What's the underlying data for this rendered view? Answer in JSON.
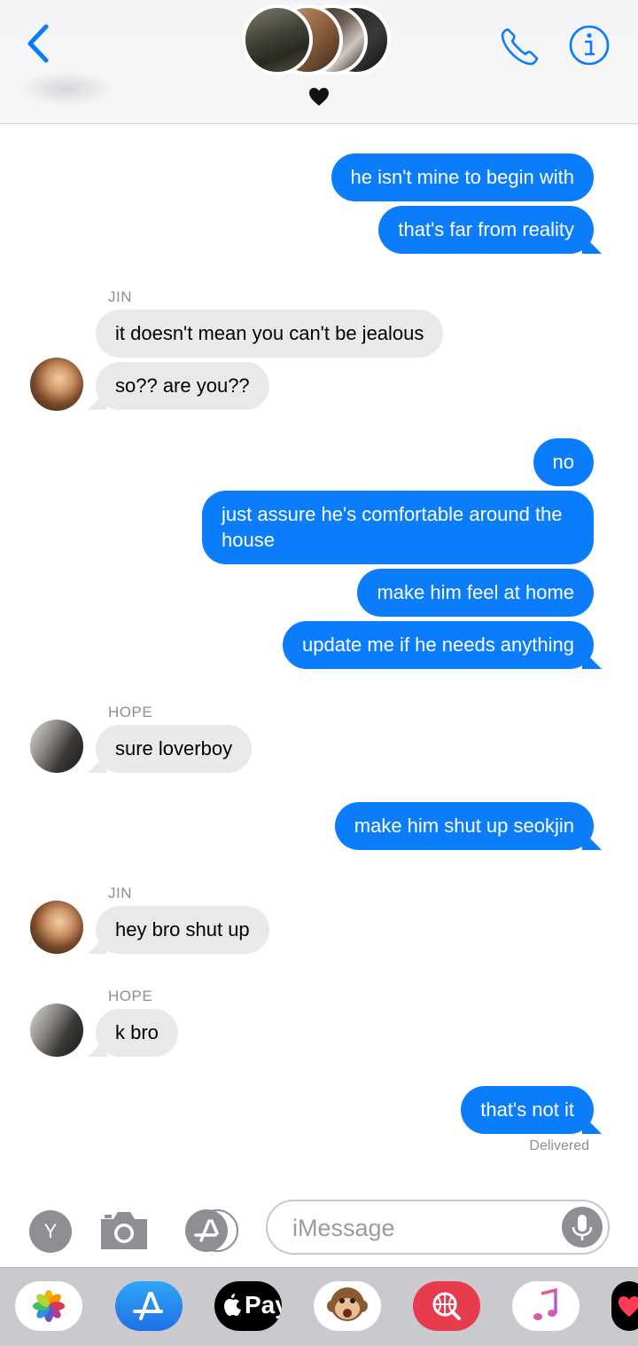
{
  "header": {
    "back_label": "Back",
    "group_icon": "black-heart"
  },
  "messages": {
    "m1": "he isn't mine to begin with",
    "m2": "that's far from reality",
    "sender_jin_1": "JIN",
    "m3": "it doesn't mean you can't be jealous",
    "m4": "so?? are you??",
    "m5": "no",
    "m6": "just assure he's comfortable around the house",
    "m7": "make him feel at home",
    "m8": "update me if he needs anything",
    "sender_hope_1": "HOPE",
    "m9": "sure loverboy",
    "m10": "make him shut up seokjin",
    "sender_jin_2": "JIN",
    "m11": "hey bro shut up",
    "sender_hope_2": "HOPE",
    "m12": "k bro",
    "m13": "that's not it",
    "status": "Delivered"
  },
  "composer": {
    "memoji_letter": "Y",
    "placeholder": "iMessage"
  },
  "drawer": {
    "apple_pay_label": "Pay"
  },
  "colors": {
    "sent_bubble": "#0b7dfb",
    "received_bubble": "#e9e9eb",
    "accent": "#0a7aff"
  }
}
